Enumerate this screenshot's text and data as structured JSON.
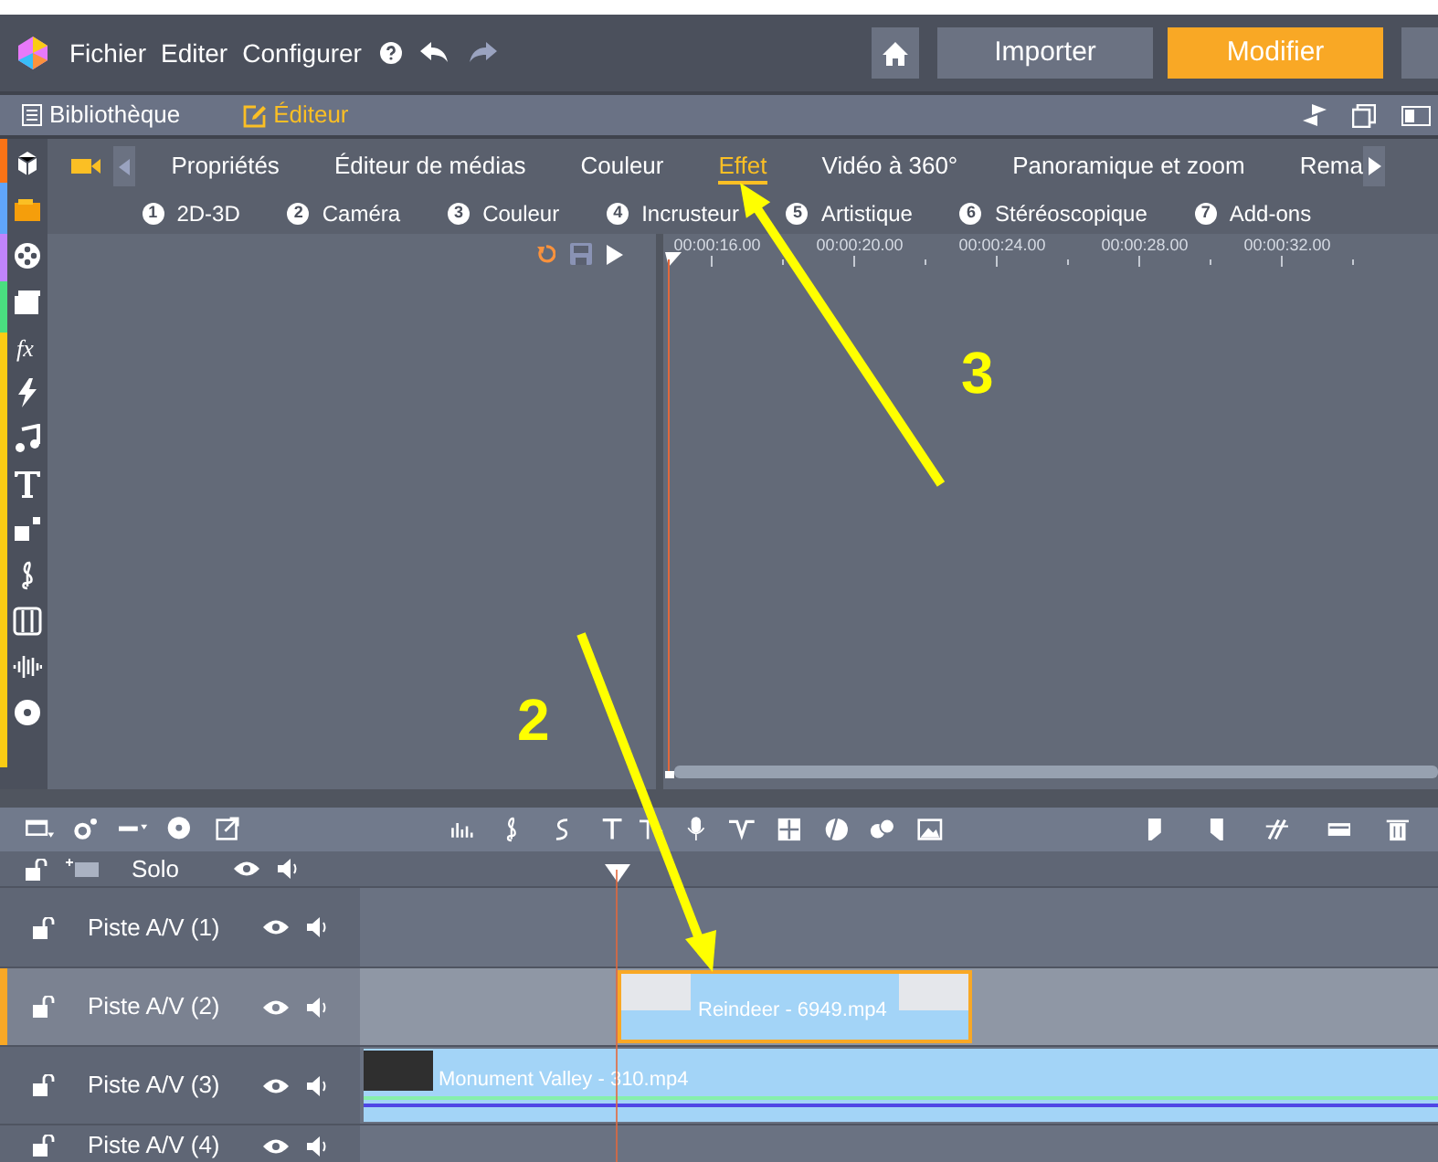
{
  "title_bar": {
    "menus": [
      "Fichier",
      "Editer",
      "Configurer"
    ],
    "buttons": [
      {
        "label": "Importer",
        "selected": false
      },
      {
        "label": "Modifier",
        "selected": true
      }
    ]
  },
  "mode_bar": {
    "items": [
      {
        "label": "Bibliothèque",
        "selected": false
      },
      {
        "label": "Éditeur",
        "selected": true
      }
    ]
  },
  "tabs": [
    {
      "label": "Propriétés",
      "selected": false
    },
    {
      "label": "Éditeur de médias",
      "selected": false
    },
    {
      "label": "Couleur",
      "selected": false
    },
    {
      "label": "Effet",
      "selected": true
    },
    {
      "label": "Vidéo à 360°",
      "selected": false
    },
    {
      "label": "Panoramique et zoom",
      "selected": false
    },
    {
      "label": "Rema",
      "selected": false
    }
  ],
  "subtabs": [
    {
      "number": "1",
      "label": "2D-3D"
    },
    {
      "number": "2",
      "label": "Caméra"
    },
    {
      "number": "3",
      "label": "Couleur"
    },
    {
      "number": "4",
      "label": "Incrusteur"
    },
    {
      "number": "5",
      "label": "Artistique"
    },
    {
      "number": "6",
      "label": "Stéréoscopique"
    },
    {
      "number": "7",
      "label": "Add-ons"
    }
  ],
  "ruler": [
    "00:00:16.00",
    "00:00:20.00",
    "00:00:24.00",
    "00:00:28.00",
    "00:00:32.00"
  ],
  "track_header": {
    "label": "Solo"
  },
  "sidebar": {
    "fx_icon_text": "fx"
  },
  "tracks": [
    {
      "name": "Piste A/V (1)",
      "selected": false
    },
    {
      "name": "Piste A/V (2)",
      "selected": true,
      "clips": [
        {
          "name": "Reindeer - 6949.mp4",
          "selected": true,
          "kind": "thumbs"
        }
      ]
    },
    {
      "name": "Piste A/V (3)",
      "selected": false,
      "clips": [
        {
          "name": "Monument Valley - 310.mp4",
          "selected": false,
          "kind": "thumb"
        }
      ]
    },
    {
      "name": "Piste A/V (4)",
      "selected": false
    }
  ],
  "annotations": [
    {
      "label": "3"
    },
    {
      "label": "2"
    }
  ]
}
